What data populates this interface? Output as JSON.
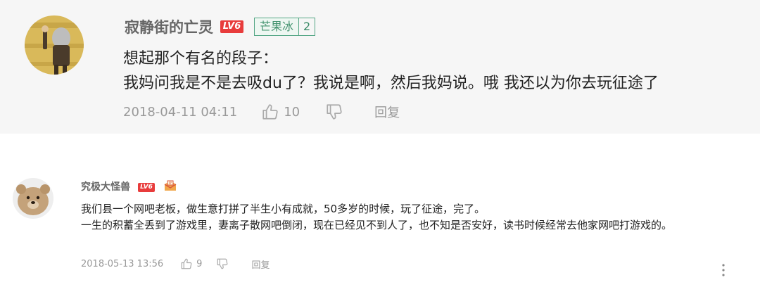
{
  "comments": [
    {
      "username": "寂静街的亡灵",
      "level": "LV6",
      "fan_badge": {
        "name": "芒果冰",
        "level": "2"
      },
      "lines": [
        "想起那个有名的段子：",
        "我妈问我是不是去吸du了？我说是啊，然后我妈说。哦 我还以为你去玩征途了"
      ],
      "date": "2018-04-11 04:11",
      "likes": "10",
      "reply_label": "回复"
    },
    {
      "username": "究极大怪兽",
      "level": "LV6",
      "lines": [
        "我们县一个网吧老板，做生意打拼了半生小有成就，50多岁的时候，玩了征途，完了。",
        "一生的积蓄全丢到了游戏里，妻离子散网吧倒闭，现在已经见不到人了，也不知是否安好，读书时候经常去他家网吧打游戏的。"
      ],
      "date": "2018-05-13 13:56",
      "likes": "9",
      "reply_label": "回复"
    }
  ],
  "colors": {
    "level_badge": "#e83c3c",
    "fan_badge": "#54a685",
    "meta_text": "#999999",
    "username": "#666666"
  },
  "icons": [
    "avatar-illustration",
    "thumbs-up-icon",
    "thumbs-down-icon",
    "gift-badge-icon",
    "more-vertical-icon"
  ]
}
